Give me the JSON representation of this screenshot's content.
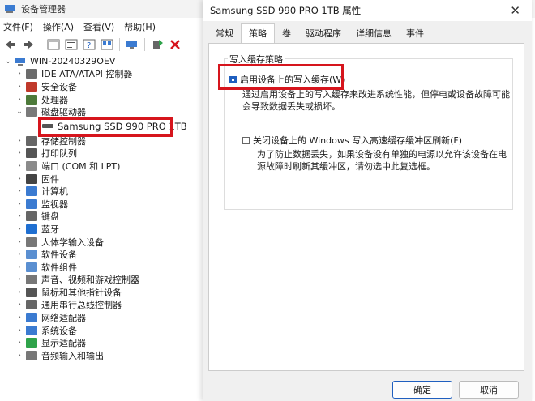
{
  "devmgr": {
    "title": "设备管理器",
    "menu": [
      "文件(F)",
      "操作(A)",
      "查看(V)",
      "帮助(H)"
    ],
    "root": "WIN-20240329OEV",
    "tree": [
      {
        "label": "IDE ATA/ATAPI 控制器",
        "icon": "ide-icon"
      },
      {
        "label": "安全设备",
        "icon": "security-icon"
      },
      {
        "label": "处理器",
        "icon": "cpu-icon"
      },
      {
        "label": "磁盘驱动器",
        "icon": "disk-icon",
        "expanded": true
      },
      {
        "label": "Samsung SSD 990 PRO 1TB",
        "icon": "ssd-icon",
        "child": true
      },
      {
        "label": "存储控制器",
        "icon": "storage-icon"
      },
      {
        "label": "打印队列",
        "icon": "printer-icon"
      },
      {
        "label": "端口 (COM 和 LPT)",
        "icon": "port-icon"
      },
      {
        "label": "固件",
        "icon": "firmware-icon"
      },
      {
        "label": "计算机",
        "icon": "computer-icon"
      },
      {
        "label": "监视器",
        "icon": "monitor-icon"
      },
      {
        "label": "键盘",
        "icon": "keyboard-icon"
      },
      {
        "label": "蓝牙",
        "icon": "bluetooth-icon"
      },
      {
        "label": "人体学输入设备",
        "icon": "hid-icon"
      },
      {
        "label": "软件设备",
        "icon": "software-device-icon"
      },
      {
        "label": "软件组件",
        "icon": "software-component-icon"
      },
      {
        "label": "声音、视频和游戏控制器",
        "icon": "sound-icon"
      },
      {
        "label": "鼠标和其他指针设备",
        "icon": "mouse-icon"
      },
      {
        "label": "通用串行总线控制器",
        "icon": "usb-icon"
      },
      {
        "label": "网络适配器",
        "icon": "network-icon"
      },
      {
        "label": "系统设备",
        "icon": "system-icon"
      },
      {
        "label": "显示适配器",
        "icon": "display-adapter-icon"
      },
      {
        "label": "音频输入和输出",
        "icon": "audio-icon"
      }
    ]
  },
  "props": {
    "title": "Samsung SSD 990 PRO 1TB 属性",
    "tabs": [
      "常规",
      "策略",
      "卷",
      "驱动程序",
      "详细信息",
      "事件"
    ],
    "active_tab": "策略",
    "group_title": "写入缓存策略",
    "cb1_label": "启用设备上的写入缓存(W)",
    "cb1_desc": "通过启用设备上的写入缓存来改进系统性能，但停电或设备故障可能会导致数据丢失或损坏。",
    "cb2_label": "关闭设备上的 Windows 写入高速缓存缓冲区刷新(F)",
    "cb2_desc": "为了防止数据丢失，如果设备没有单独的电源以允许该设备在电源故障时刷新其缓冲区，请勿选中此复选框。",
    "ok": "确定",
    "cancel": "取消"
  },
  "colors": {
    "highlight": "#d6151d",
    "accent": "#1f5fbf"
  }
}
